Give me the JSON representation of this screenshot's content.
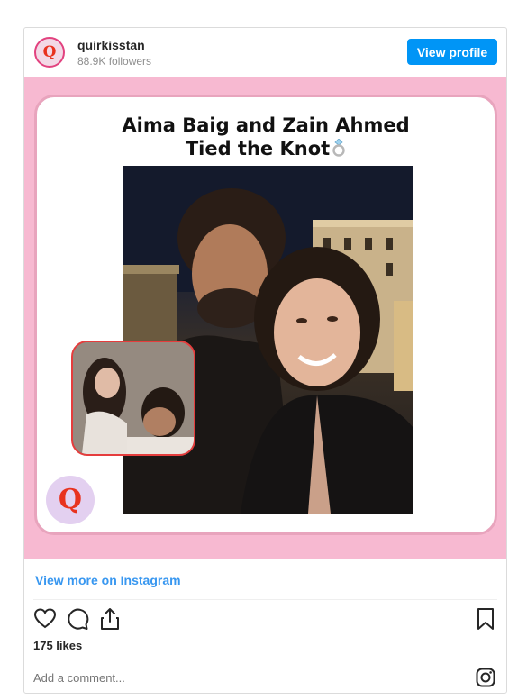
{
  "header": {
    "username": "quirkisstan",
    "followers": "88.9K followers",
    "view_profile_label": "View profile",
    "avatar_letter": "Q"
  },
  "post": {
    "title_line1": "Aima Baig and Zain Ahmed",
    "title_line2": "Tied the Knot",
    "badge_letter": "Q",
    "bg_color": "#f7b9d1",
    "frame_border_color": "#e8a4bd",
    "inset_border_color": "#e53d3d"
  },
  "footer": {
    "view_more_label": "View more on Instagram",
    "likes": "175 likes",
    "comment_placeholder": "Add a comment...",
    "icons": [
      "heart-icon",
      "comment-icon",
      "share-icon",
      "bookmark-icon",
      "instagram-icon"
    ]
  },
  "colors": {
    "accent": "#0095f6",
    "link": "#3897f0"
  }
}
